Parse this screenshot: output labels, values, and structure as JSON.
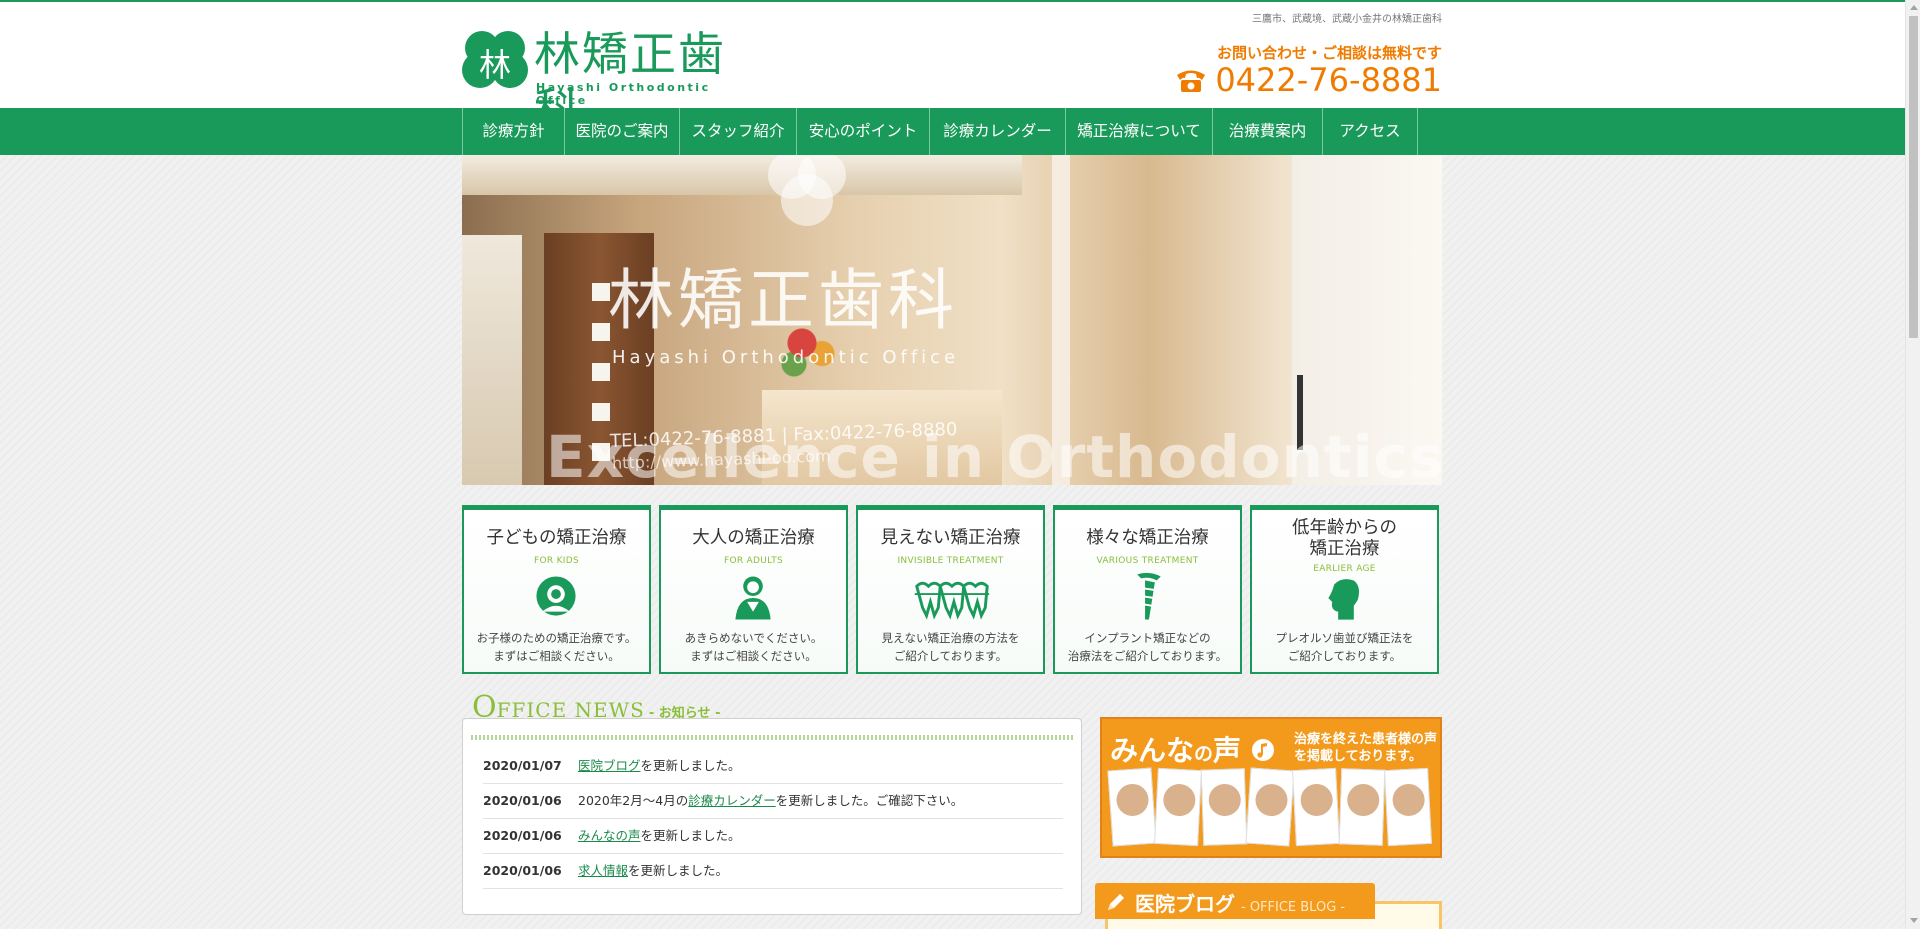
{
  "header": {
    "tagline": "三鷹市、武蔵境、武蔵小金井の林矯正歯科",
    "logo_title": "林矯正歯科",
    "logo_sub": "Hayashi Orthodontic Office",
    "logo_mark_text": "林",
    "contact_label": "お問い合わせ・ご相談は無料です",
    "phone": "0422-76-8881",
    "brand_color": "#1a9a5a",
    "accent_color": "#ef7c00"
  },
  "nav": {
    "items": [
      {
        "label": "診療方針"
      },
      {
        "label": "医院のご案内"
      },
      {
        "label": "スタッフ紹介"
      },
      {
        "label": "安心のポイント"
      },
      {
        "label": "診療カレンダー"
      },
      {
        "label": "矯正治療について"
      },
      {
        "label": "治療費案内"
      },
      {
        "label": "アクセス"
      }
    ]
  },
  "hero": {
    "title": "林矯正歯科",
    "subtitle": "Hayashi Orthodontic Office",
    "tel": "TEL:0422-76-8881 | Fax:0422-76-8880",
    "url": "http://www.hayashi-oo.com",
    "tagline": "Excellence in Orthodontics"
  },
  "cards": [
    {
      "title": "子どもの矯正治療",
      "en": "FOR KIDS",
      "icon": "child-icon",
      "desc1": "お子様のための矯正治療です。",
      "desc2": "まずはご相談ください。"
    },
    {
      "title": "大人の矯正治療",
      "en": "FOR ADULTS",
      "icon": "adult-icon",
      "desc1": "あきらめないでください。",
      "desc2": "まずはご相談ください。"
    },
    {
      "title": "見えない矯正治療",
      "en": "INVISIBLE TREATMENT",
      "icon": "teeth-icon",
      "desc1": "見えない矯正治療の方法を",
      "desc2": "ご紹介しております。"
    },
    {
      "title": "様々な矯正治療",
      "en": "VARIOUS TREATMENT",
      "icon": "implant-icon",
      "desc1": "インプラント矯正などの",
      "desc2": "治療法をご紹介しております。"
    },
    {
      "title": "低年齢からの",
      "title2": "矯正治療",
      "en": "EARLIER AGE",
      "icon": "profile-icon",
      "desc1": "プレオルソ歯並び矯正法を",
      "desc2": "ご紹介しております。"
    }
  ],
  "news": {
    "heading_big": "O",
    "heading_rest": "FFICE NEWS",
    "heading_jp": "- お知らせ -",
    "items": [
      {
        "date": "2020/01/07",
        "pre": "",
        "link": "医院ブログ",
        "post": "を更新しました。"
      },
      {
        "date": "2020/01/06",
        "pre": "2020年2月～4月の",
        "link": "診療カレンダー",
        "post": "を更新しました。ご確認下さい。"
      },
      {
        "date": "2020/01/06",
        "pre": "",
        "link": "みんなの声",
        "post": "を更新しました。"
      },
      {
        "date": "2020/01/06",
        "pre": "",
        "link": "求人情報",
        "post": "を更新しました。"
      }
    ]
  },
  "voice": {
    "title_a": "みんな",
    "title_b": "の",
    "title_c": "声",
    "note": "治療を終えた患者様の声を掲載しております。"
  },
  "blog": {
    "title": "医院ブログ",
    "sub": "- OFFICE BLOG -"
  }
}
